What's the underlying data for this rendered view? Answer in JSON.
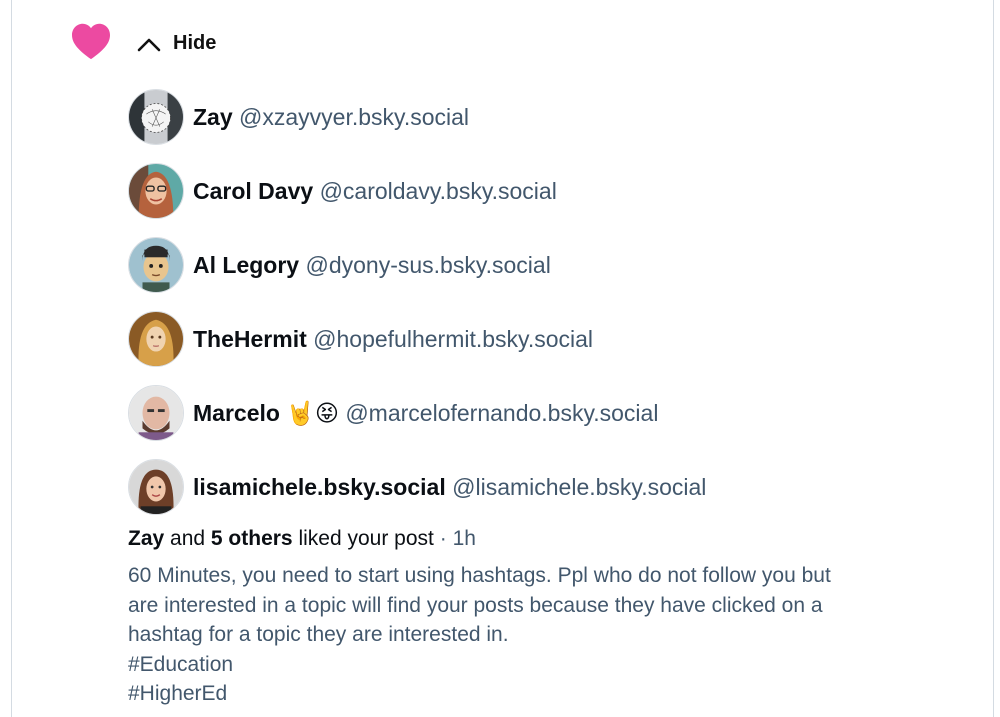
{
  "header": {
    "hide_label": "Hide",
    "accent_color": "#ec4899"
  },
  "likers": [
    {
      "display_name": "Zay",
      "handle": "@xzayvyer.bsky.social",
      "avatar": "avatar-zay"
    },
    {
      "display_name": "Carol Davy",
      "handle": "@caroldavy.bsky.social",
      "avatar": "avatar-carol"
    },
    {
      "display_name": "Al Legory",
      "handle": "@dyony-sus.bsky.social",
      "avatar": "avatar-al"
    },
    {
      "display_name": "TheHermit",
      "handle": "@hopefulhermit.bsky.social",
      "avatar": "avatar-hermit"
    },
    {
      "display_name": "Marcelo 🤘😝",
      "handle": "@marcelofernando.bsky.social",
      "avatar": "avatar-marcelo"
    },
    {
      "display_name": "lisamichele.bsky.social",
      "handle": "@lisamichele.bsky.social",
      "avatar": "avatar-lisa"
    }
  ],
  "notification": {
    "first_name": "Zay",
    "and_text": "and",
    "others_text": "5 others",
    "action_text": "liked your post",
    "separator": "·",
    "time": "1h"
  },
  "post": {
    "lines": [
      "60 Minutes, you need to start using hashtags. Ppl who do not follow you but",
      "are interested in a topic will find your posts because they have clicked on a",
      "hashtag for a topic they are interested in.",
      "#Education",
      "#HigherEd"
    ]
  }
}
